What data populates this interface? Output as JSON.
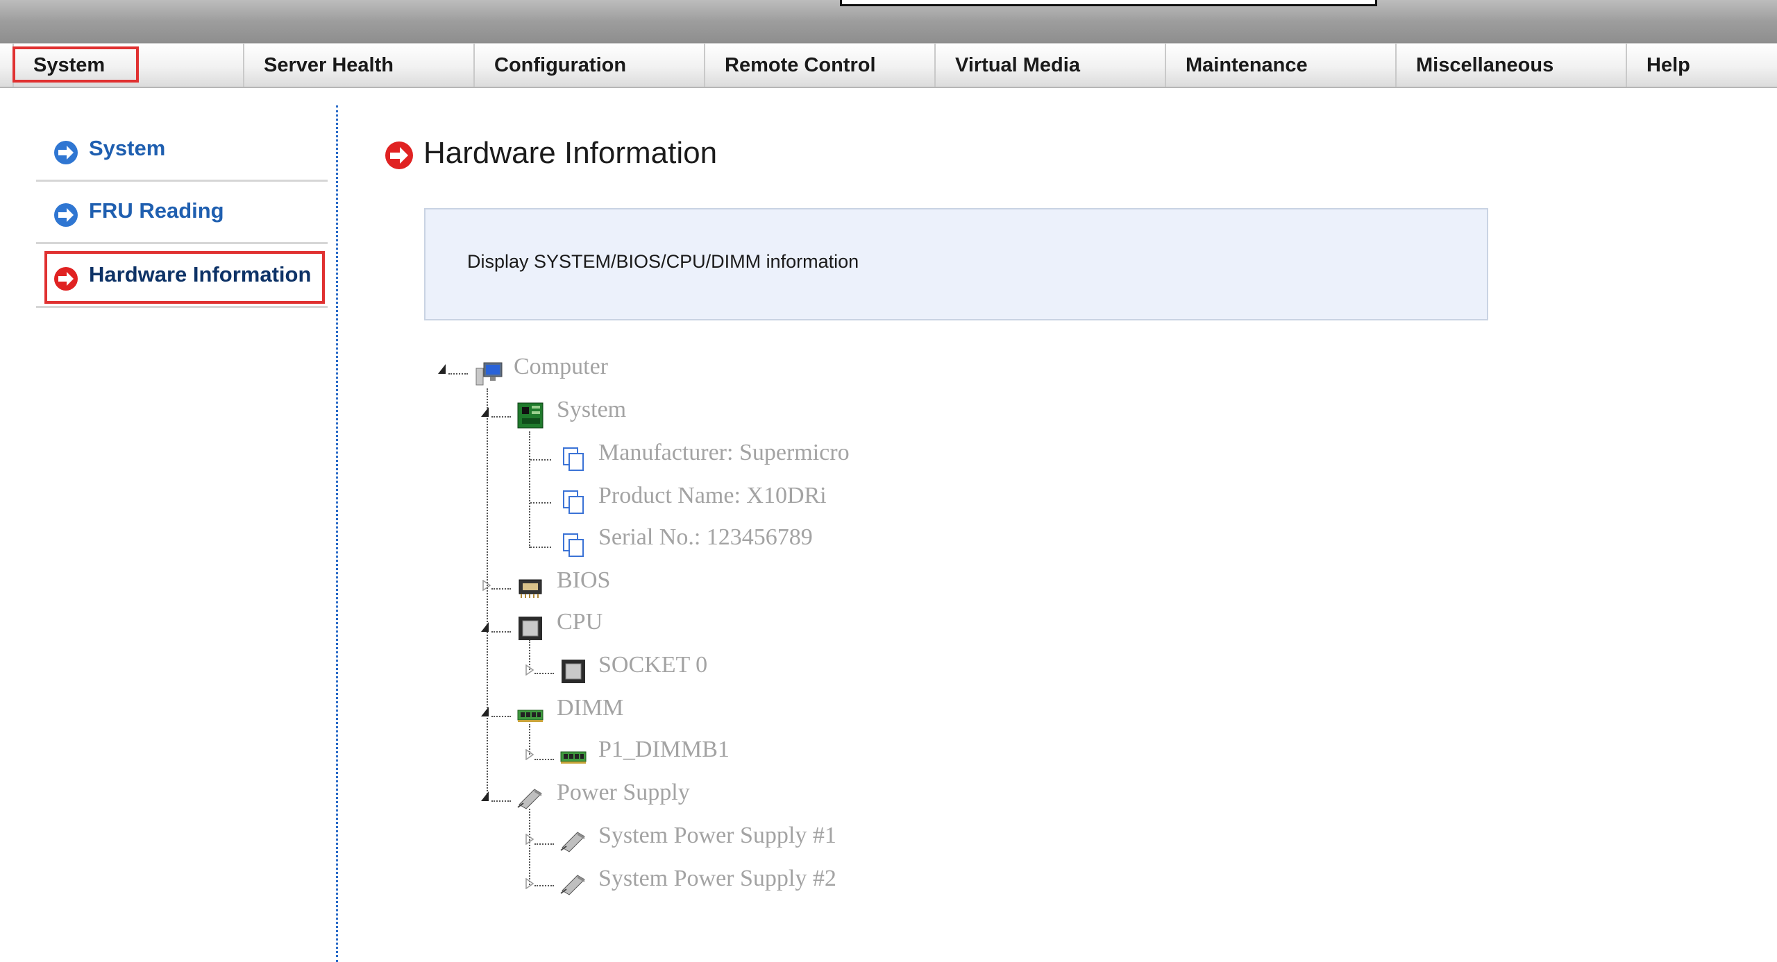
{
  "menu": {
    "items": [
      {
        "label": "System"
      },
      {
        "label": "Server Health"
      },
      {
        "label": "Configuration"
      },
      {
        "label": "Remote Control"
      },
      {
        "label": "Virtual Media"
      },
      {
        "label": "Maintenance"
      },
      {
        "label": "Miscellaneous"
      },
      {
        "label": "Help"
      }
    ]
  },
  "sidebar": {
    "items": [
      {
        "label": "System"
      },
      {
        "label": "FRU Reading"
      },
      {
        "label": "Hardware Information"
      }
    ]
  },
  "page": {
    "title": "Hardware Information",
    "description": "Display SYSTEM/BIOS/CPU/DIMM information"
  },
  "tree": {
    "computer": "Computer",
    "system": "System",
    "manufacturer": "Manufacturer: Supermicro",
    "product_name": "Product Name: X10DRi",
    "serial_no": "Serial No.: 123456789",
    "bios": "BIOS",
    "cpu": "CPU",
    "socket0": "SOCKET 0",
    "dimm": "DIMM",
    "p1_dimmb1": "P1_DIMMB1",
    "power_supply": "Power Supply",
    "psu1": "System Power Supply #1",
    "psu2": "System Power Supply #2"
  },
  "colors": {
    "highlight": "#e03131",
    "link": "#1f5fb0",
    "tree_text": "#a3a3a3"
  }
}
